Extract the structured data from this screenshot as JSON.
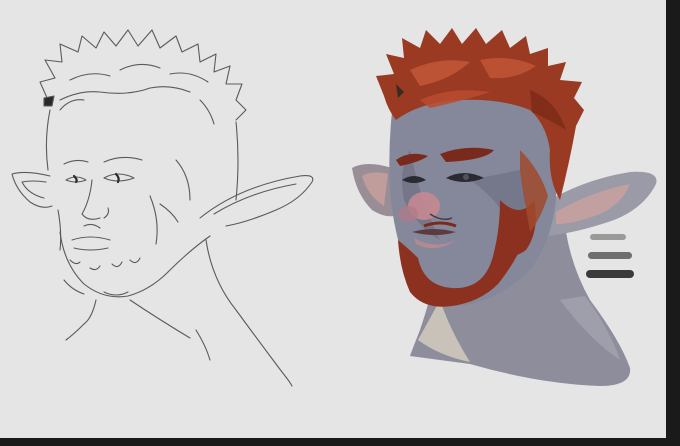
{
  "artwork": {
    "left_panel": "line-sketch",
    "right_panel": "painted",
    "colors": {
      "background": "#e5e5e5",
      "sketch_line": "#5a5a5a",
      "hair": "#9a3a22",
      "hair_light": "#c45a3a",
      "beard": "#8a3322",
      "skin": "#8a8a9a",
      "skin_dark": "#5f6070",
      "skin_warm": "#a88a8a",
      "ear_inner": "#b39090",
      "neck_light": "#c8c2b8"
    },
    "swatches": [
      "#9a9a9a",
      "#6e6e6e",
      "#3a3a3a"
    ]
  }
}
